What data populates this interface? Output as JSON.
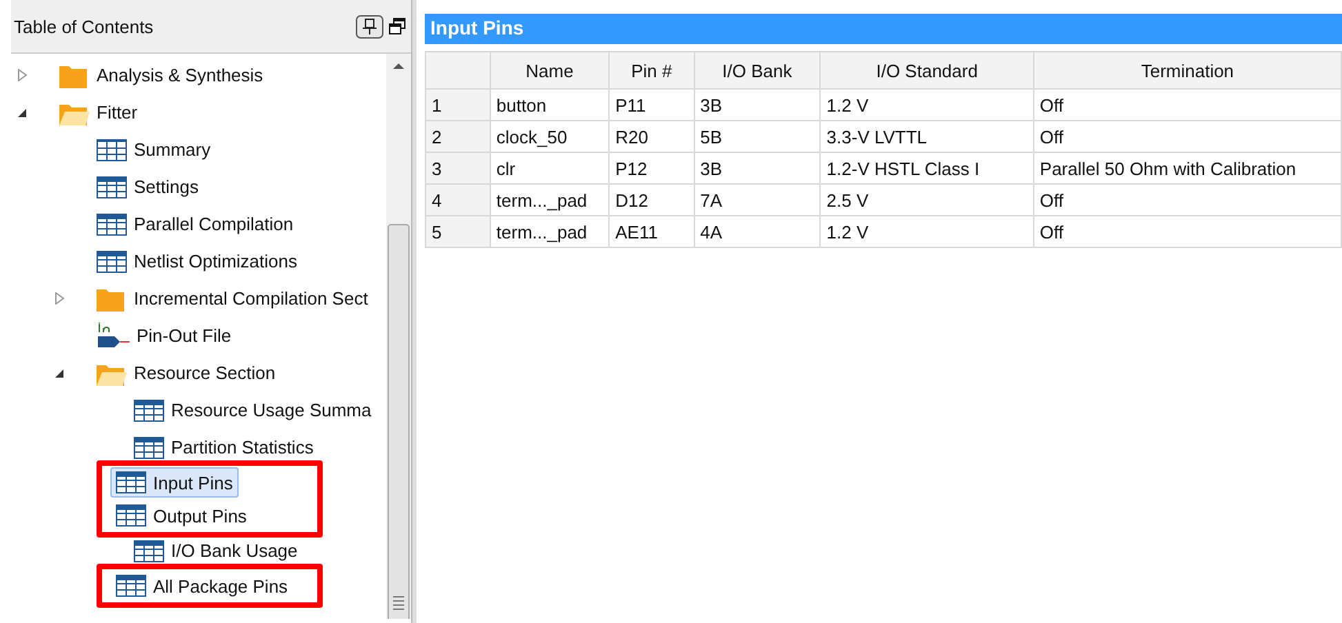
{
  "toc": {
    "title": "Table of Contents",
    "items": [
      {
        "label": "Analysis & Synthesis",
        "kind": "folder",
        "expanded": false,
        "selected": false,
        "boxed": false
      },
      {
        "label": "Fitter",
        "kind": "folder",
        "expanded": true,
        "selected": false,
        "boxed": false,
        "children": [
          {
            "label": "Summary",
            "kind": "summary",
            "selected": false,
            "boxed": false
          },
          {
            "label": "Settings",
            "kind": "table",
            "selected": false,
            "boxed": false
          },
          {
            "label": "Parallel Compilation",
            "kind": "table",
            "selected": false,
            "boxed": false
          },
          {
            "label": "Netlist Optimizations",
            "kind": "table",
            "selected": false,
            "boxed": false
          },
          {
            "label": "Incremental Compilation Sect",
            "kind": "folder",
            "expanded": false,
            "selected": false,
            "boxed": false
          },
          {
            "label": "Pin-Out File",
            "kind": "pinfile",
            "selected": false,
            "boxed": false
          },
          {
            "label": "Resource Section",
            "kind": "folder",
            "expanded": true,
            "selected": false,
            "boxed": false,
            "children": [
              {
                "label": "Resource Usage Summa",
                "kind": "table",
                "selected": false,
                "boxed": false
              },
              {
                "label": "Partition Statistics",
                "kind": "table",
                "selected": false,
                "boxed": false
              },
              {
                "label": "Input Pins",
                "kind": "table",
                "selected": true,
                "boxed": true
              },
              {
                "label": "Output Pins",
                "kind": "table",
                "selected": false,
                "boxed": true
              },
              {
                "label": "I/O Bank Usage",
                "kind": "table",
                "selected": false,
                "boxed": false
              },
              {
                "label": "All Package Pins",
                "kind": "table",
                "selected": false,
                "boxed": true
              }
            ]
          }
        ]
      }
    ]
  },
  "report": {
    "title": "Input Pins",
    "columns": [
      "",
      "Name",
      "Pin #",
      "I/O Bank",
      "I/O Standard",
      "Termination"
    ],
    "rows": [
      [
        "1",
        "button",
        "P11",
        "3B",
        "1.2 V",
        "Off"
      ],
      [
        "2",
        "clock_50",
        "R20",
        "5B",
        "3.3-V LVTTL",
        "Off"
      ],
      [
        "3",
        "clr",
        "P12",
        "3B",
        "1.2-V HSTL Class I",
        "Parallel 50 Ohm with Calibration"
      ],
      [
        "4",
        "term..._pad",
        "D12",
        "7A",
        "2.5 V",
        "Off"
      ],
      [
        "5",
        "term..._pad",
        "AE11",
        "4A",
        "1.2 V",
        "Off"
      ]
    ]
  }
}
